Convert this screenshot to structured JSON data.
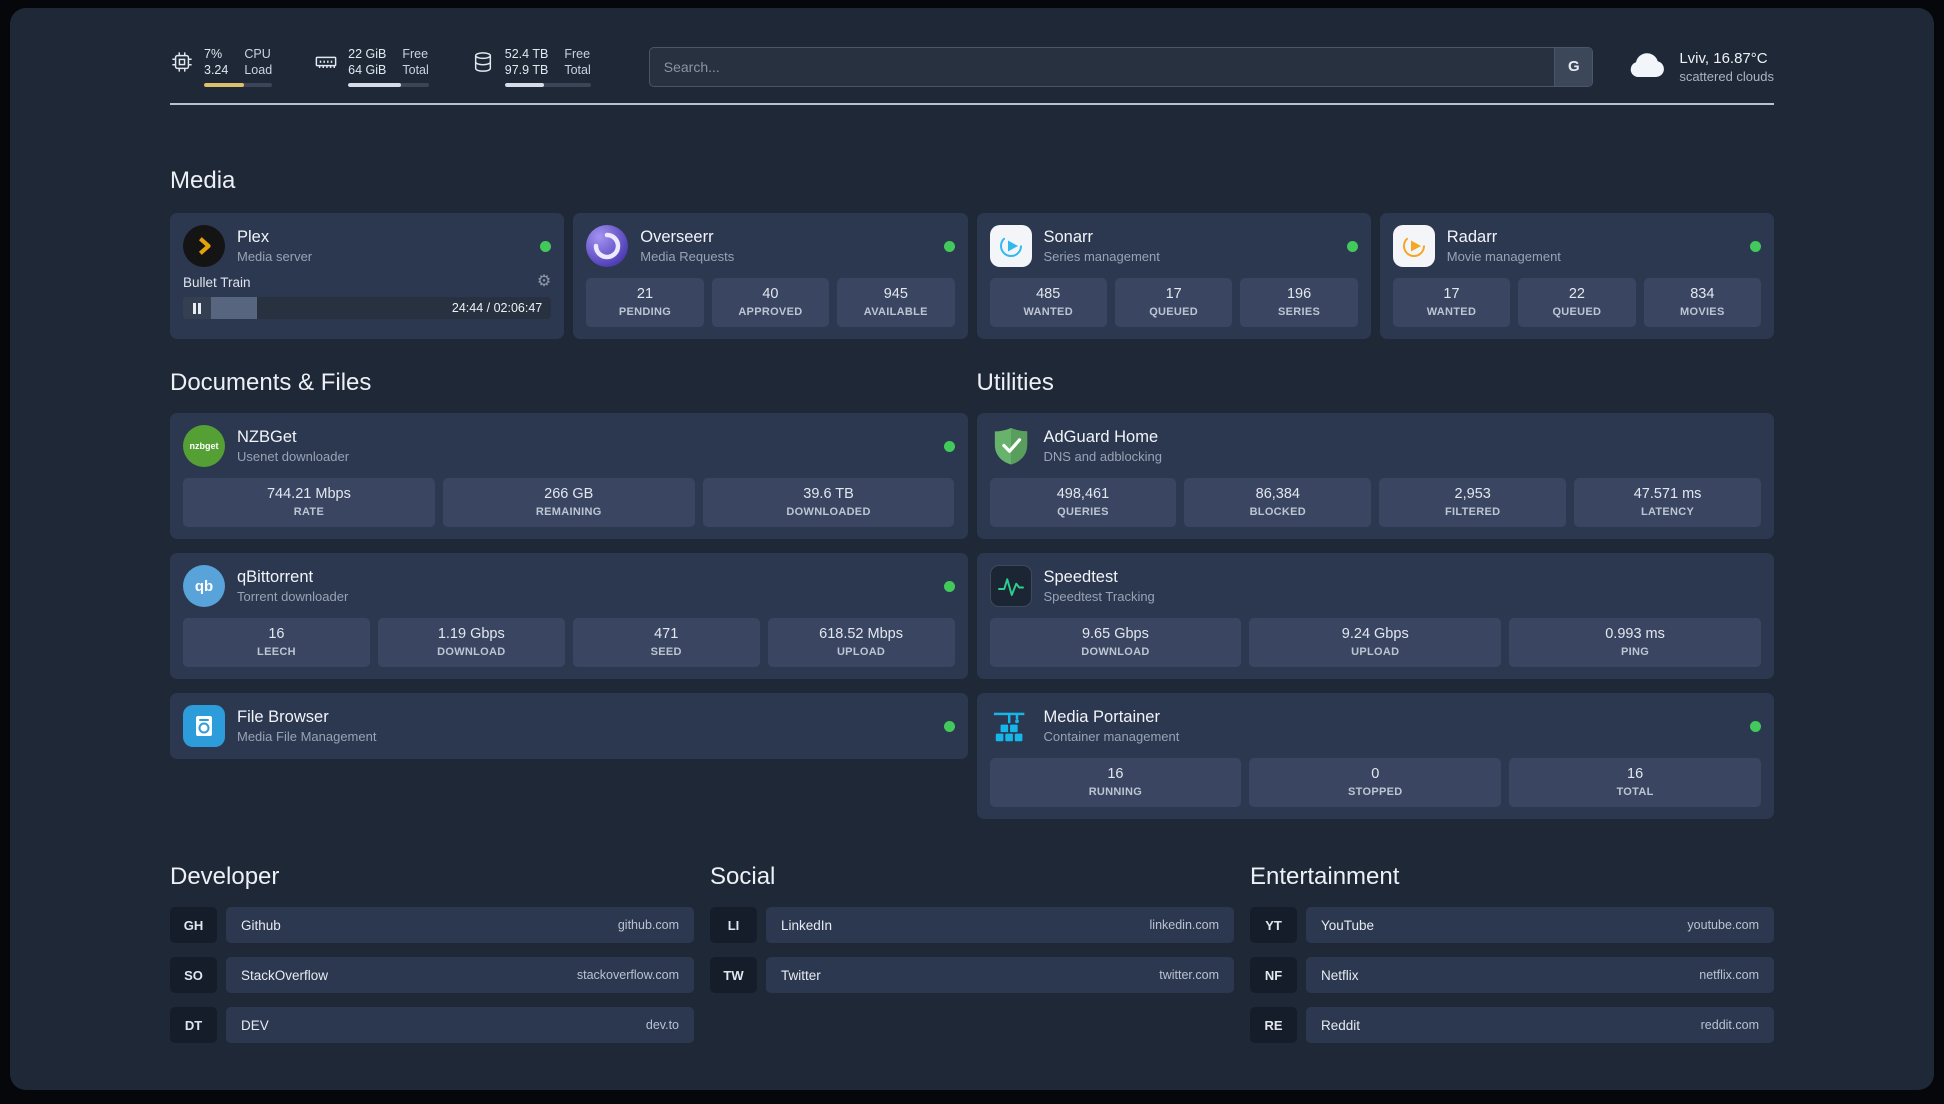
{
  "colors": {
    "page_bg": "#1e2837",
    "card_bg": "#2c3850",
    "stat_bg": "#3a4661",
    "status_green": "#42c95c",
    "plex_gold": "#e5a00d",
    "sonarr_blue": "#2fb9ef",
    "radarr_amber": "#f5a623",
    "adguard_green": "#68b36b",
    "portainer_blue": "#16b6ea",
    "cpu_bar": "#dcc16a"
  },
  "topbar": {
    "cpu": {
      "values": [
        "7%",
        "3.24"
      ],
      "labels": [
        "CPU",
        "Load"
      ],
      "progress": 58
    },
    "ram": {
      "values": [
        "22 GiB",
        "64 GiB"
      ],
      "labels": [
        "Free",
        "Total"
      ],
      "progress": 66
    },
    "disk": {
      "values": [
        "52.4 TB",
        "97.9 TB"
      ],
      "labels": [
        "Free",
        "Total"
      ],
      "progress": 46
    },
    "search": {
      "placeholder": "Search...",
      "engine": "G"
    },
    "weather": {
      "location": "Lviv, 16.87°C",
      "condition": "scattered clouds"
    }
  },
  "sections": {
    "media": "Media",
    "documents": "Documents & Files",
    "utilities": "Utilities",
    "developer": "Developer",
    "social": "Social",
    "entertainment": "Entertainment"
  },
  "apps": {
    "plex": {
      "name": "Plex",
      "subtitle": "Media server",
      "player_title": "Bullet Train",
      "player_time": "24:44 / 02:06:47",
      "player_progress": 20
    },
    "overseerr": {
      "name": "Overseerr",
      "subtitle": "Media Requests",
      "stats": [
        {
          "value": "21",
          "label": "PENDING"
        },
        {
          "value": "40",
          "label": "APPROVED"
        },
        {
          "value": "945",
          "label": "AVAILABLE"
        }
      ]
    },
    "sonarr": {
      "name": "Sonarr",
      "subtitle": "Series management",
      "stats": [
        {
          "value": "485",
          "label": "WANTED"
        },
        {
          "value": "17",
          "label": "QUEUED"
        },
        {
          "value": "196",
          "label": "SERIES"
        }
      ]
    },
    "radarr": {
      "name": "Radarr",
      "subtitle": "Movie management",
      "stats": [
        {
          "value": "17",
          "label": "WANTED"
        },
        {
          "value": "22",
          "label": "QUEUED"
        },
        {
          "value": "834",
          "label": "MOVIES"
        }
      ]
    },
    "nzbget": {
      "name": "NZBGet",
      "subtitle": "Usenet downloader",
      "icon_text": "nzbget",
      "stats": [
        {
          "value": "744.21 Mbps",
          "label": "RATE"
        },
        {
          "value": "266 GB",
          "label": "REMAINING"
        },
        {
          "value": "39.6 TB",
          "label": "DOWNLOADED"
        }
      ]
    },
    "qbittorrent": {
      "name": "qBittorrent",
      "subtitle": "Torrent downloader",
      "icon_text": "qb",
      "stats": [
        {
          "value": "16",
          "label": "LEECH"
        },
        {
          "value": "1.19 Gbps",
          "label": "DOWNLOAD"
        },
        {
          "value": "471",
          "label": "SEED"
        },
        {
          "value": "618.52 Mbps",
          "label": "UPLOAD"
        }
      ]
    },
    "filebrowser": {
      "name": "File Browser",
      "subtitle": "Media File Management"
    },
    "adguard": {
      "name": "AdGuard Home",
      "subtitle": "DNS and adblocking",
      "stats": [
        {
          "value": "498,461",
          "label": "QUERIES"
        },
        {
          "value": "86,384",
          "label": "BLOCKED"
        },
        {
          "value": "2,953",
          "label": "FILTERED"
        },
        {
          "value": "47.571 ms",
          "label": "LATENCY"
        }
      ]
    },
    "speedtest": {
      "name": "Speedtest",
      "subtitle": "Speedtest Tracking",
      "stats": [
        {
          "value": "9.65 Gbps",
          "label": "DOWNLOAD"
        },
        {
          "value": "9.24 Gbps",
          "label": "UPLOAD"
        },
        {
          "value": "0.993 ms",
          "label": "PING"
        }
      ]
    },
    "portainer": {
      "name": "Media Portainer",
      "subtitle": "Container management",
      "stats": [
        {
          "value": "16",
          "label": "RUNNING"
        },
        {
          "value": "0",
          "label": "STOPPED"
        },
        {
          "value": "16",
          "label": "TOTAL"
        }
      ]
    }
  },
  "bookmarks": {
    "developer": [
      {
        "abbr": "GH",
        "name": "Github",
        "url": "github.com"
      },
      {
        "abbr": "SO",
        "name": "StackOverflow",
        "url": "stackoverflow.com"
      },
      {
        "abbr": "DT",
        "name": "DEV",
        "url": "dev.to"
      }
    ],
    "social": [
      {
        "abbr": "LI",
        "name": "LinkedIn",
        "url": "linkedin.com"
      },
      {
        "abbr": "TW",
        "name": "Twitter",
        "url": "twitter.com"
      }
    ],
    "entertainment": [
      {
        "abbr": "YT",
        "name": "YouTube",
        "url": "youtube.com"
      },
      {
        "abbr": "NF",
        "name": "Netflix",
        "url": "netflix.com"
      },
      {
        "abbr": "RE",
        "name": "Reddit",
        "url": "reddit.com"
      }
    ]
  }
}
